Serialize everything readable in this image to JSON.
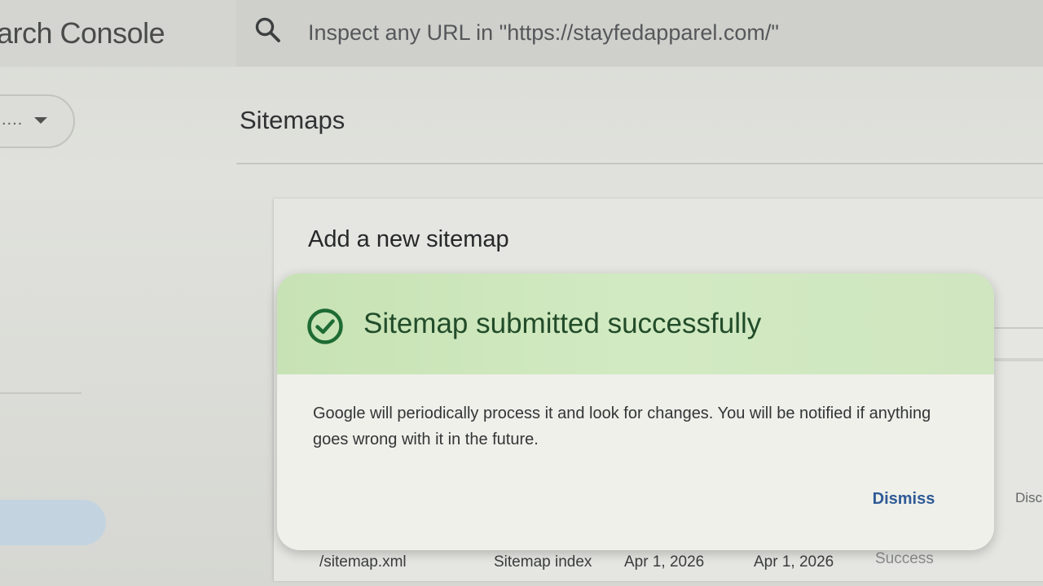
{
  "app": {
    "title": "arch Console"
  },
  "search": {
    "placeholder": "Inspect any URL in \"https://stayfedapparel.com/\""
  },
  "property_selector": {
    "text": "...."
  },
  "page": {
    "heading": "Sitemaps"
  },
  "add_sitemap_card": {
    "title": "Add a new sitemap"
  },
  "dialog": {
    "title": "Sitemap submitted successfully",
    "body": "Google will periodically process it and look for changes. You will be notified if anything goes wrong with it in the future.",
    "dismiss_label": "Dismiss"
  },
  "table": {
    "partial_column_header": "Disc",
    "rows": [
      {
        "sitemap": "/sitemap.xml",
        "type": "Sitemap index",
        "submitted": "Apr 1, 2026",
        "last_read": "Apr 1, 2026",
        "status": "Success"
      }
    ]
  },
  "colors": {
    "success_header": "#cfe6c0",
    "success_text": "#224c2a",
    "check_icon": "#1e6b34",
    "link": "#2f5a96"
  },
  "icons": {
    "search": "search-icon",
    "check": "check-circle-icon",
    "dropdown": "caret-down-icon"
  }
}
